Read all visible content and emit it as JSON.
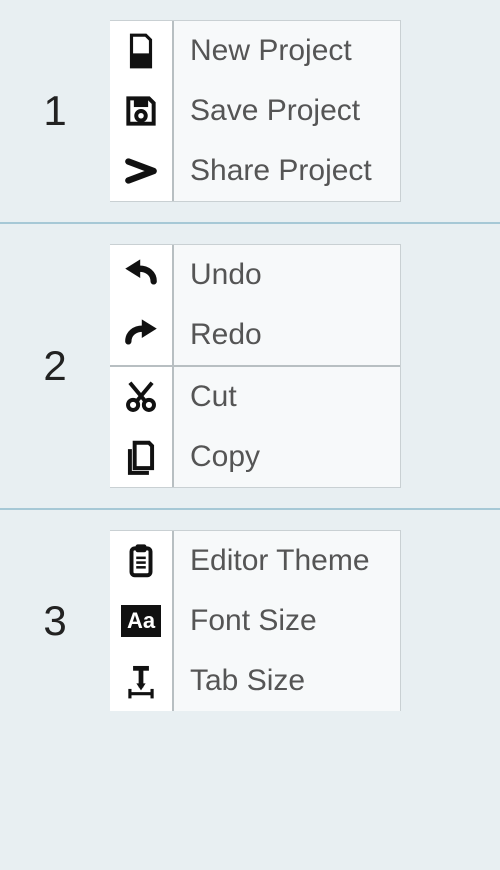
{
  "sections": [
    {
      "number": "1",
      "groups": [
        [
          {
            "icon": "new-project-icon",
            "label": "New Project"
          },
          {
            "icon": "save-project-icon",
            "label": "Save Project"
          },
          {
            "icon": "share-project-icon",
            "label": "Share Project"
          }
        ]
      ]
    },
    {
      "number": "2",
      "groups": [
        [
          {
            "icon": "undo-icon",
            "label": "Undo"
          },
          {
            "icon": "redo-icon",
            "label": "Redo"
          }
        ],
        [
          {
            "icon": "cut-icon",
            "label": "Cut"
          },
          {
            "icon": "copy-icon",
            "label": "Copy"
          }
        ]
      ]
    },
    {
      "number": "3",
      "groups": [
        [
          {
            "icon": "clipboard-icon",
            "label": "Editor Theme"
          },
          {
            "icon": "font-size-icon",
            "label": "Font Size"
          },
          {
            "icon": "tab-size-icon",
            "label": "Tab Size"
          }
        ]
      ]
    }
  ]
}
